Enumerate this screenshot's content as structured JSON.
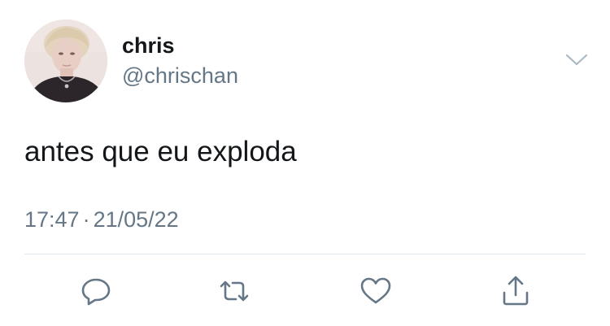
{
  "tweet": {
    "author": {
      "display_name": "chris",
      "handle": "@chrischan"
    },
    "text": "antes que eu exploda",
    "time": "17:47",
    "separator": "·",
    "date": "21/05/22"
  },
  "icons": {
    "more": "chevron-down-icon",
    "reply": "reply-icon",
    "retweet": "retweet-icon",
    "like": "heart-icon",
    "share": "share-icon"
  },
  "colors": {
    "text": "#14171a",
    "secondary": "#657786",
    "divider": "#e1e8ed",
    "icon": "#657786"
  }
}
